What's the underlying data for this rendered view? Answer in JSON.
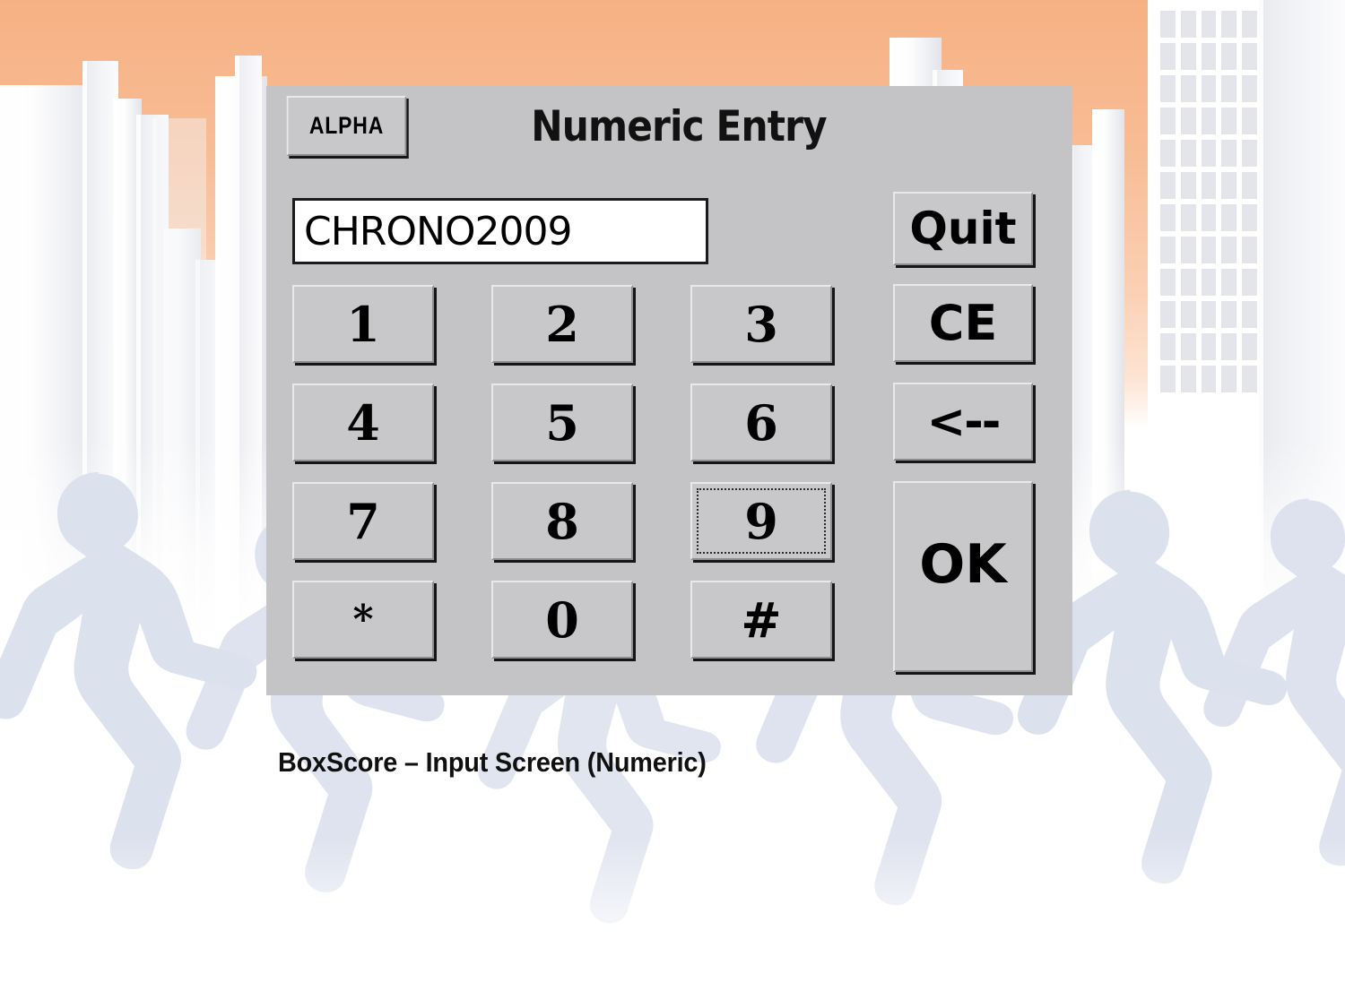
{
  "dialog": {
    "title": "Numeric Entry",
    "alpha_button": "ALPHA",
    "display": {
      "value": "CHRONO2009",
      "placeholder": ""
    },
    "keypad": [
      {
        "label": "1",
        "focused": false
      },
      {
        "label": "2",
        "focused": false
      },
      {
        "label": "3",
        "focused": false
      },
      {
        "label": "4",
        "focused": false
      },
      {
        "label": "5",
        "focused": false
      },
      {
        "label": "6",
        "focused": false
      },
      {
        "label": "7",
        "focused": false
      },
      {
        "label": "9",
        "focused": true
      },
      {
        "label": "8",
        "focused": false
      },
      {
        "label": "*",
        "focused": false
      },
      {
        "label": "0",
        "focused": false
      },
      {
        "label": "#",
        "focused": false
      }
    ],
    "keys": {
      "k1": "1",
      "k2": "2",
      "k3": "3",
      "k4": "4",
      "k5": "5",
      "k6": "6",
      "k7": "7",
      "k8": "8",
      "k9": "9",
      "kstar": "*",
      "k0": "0",
      "khash": "#"
    },
    "side_buttons": {
      "quit": "Quit",
      "ce": "CE",
      "backspace": "<--",
      "ok": "OK"
    },
    "colors": {
      "face": "#c4c4c6",
      "button_face": "#c8c8ca",
      "button_light": "#e9e9ea",
      "button_dark": "#8e8e90",
      "shadow": "#151515",
      "text": "#000000",
      "field_background": "#ffffff",
      "field_border": "#1b1b1b"
    }
  },
  "caption": {
    "text": "BoxScore – Input Screen (Numeric)"
  },
  "background": {
    "sky_top": "#f6b183",
    "sky_bottom": "#ffffff",
    "building_light": "#ffffff",
    "building_shade": "#e2e4ea",
    "runner_color": "#dce1ee"
  }
}
